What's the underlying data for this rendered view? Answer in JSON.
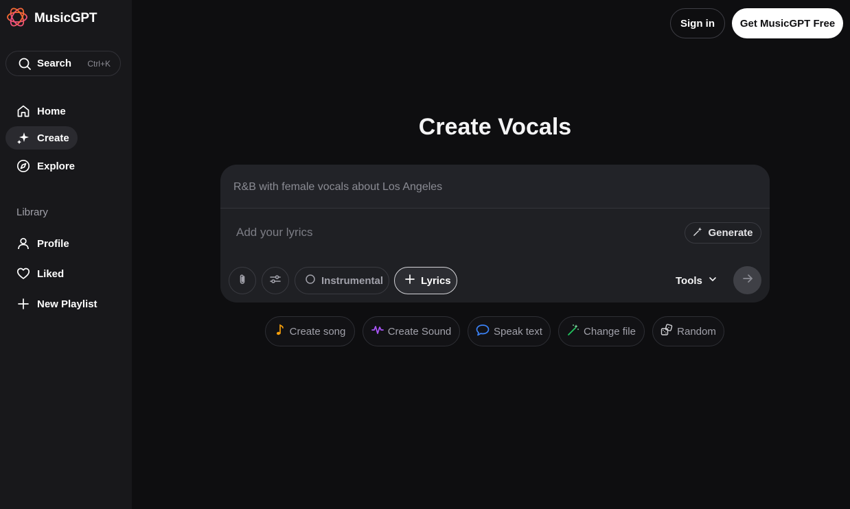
{
  "app": {
    "name": "MusicGPT"
  },
  "sidebar": {
    "search": {
      "label": "Search",
      "shortcut": "Ctrl+K"
    },
    "nav": [
      {
        "label": "Home",
        "icon": "home-icon"
      },
      {
        "label": "Create",
        "icon": "sparkle-icon",
        "active": true
      },
      {
        "label": "Explore",
        "icon": "compass-icon"
      }
    ],
    "library_label": "Library",
    "library": [
      {
        "label": "Profile",
        "icon": "user-icon"
      },
      {
        "label": "Liked",
        "icon": "heart-icon"
      },
      {
        "label": "New Playlist",
        "icon": "plus-icon"
      }
    ]
  },
  "header": {
    "signin_label": "Sign in",
    "cta_label": "Get MusicGPT Free"
  },
  "main": {
    "title": "Create Vocals",
    "prompt": {
      "placeholder": "R&B with female vocals about Los Angeles"
    },
    "lyrics": {
      "placeholder": "Add your lyrics"
    },
    "generate_label": "Generate",
    "toolbar": {
      "attach_icon": "paperclip-icon",
      "settings_icon": "sliders-icon",
      "instrumental_label": "Instrumental",
      "lyrics_label": "Lyrics",
      "tools_label": "Tools"
    },
    "quick_actions": [
      {
        "label": "Create song",
        "icon": "music-note-icon",
        "color": "#f59e0b"
      },
      {
        "label": "Create Sound",
        "icon": "waveform-icon",
        "color": "#a855f7"
      },
      {
        "label": "Speak text",
        "icon": "speech-bubble-icon",
        "color": "#3b82f6"
      },
      {
        "label": "Change file",
        "icon": "magic-wand-icon",
        "color": "#22c55e"
      },
      {
        "label": "Random",
        "icon": "dice-icon",
        "color": "#d4d4d8"
      }
    ]
  },
  "colors": {
    "background": "#0e0e10",
    "sidebar": "#18181b",
    "composer": "#1f2024",
    "logo_gradient": [
      "#f97316",
      "#ec4899"
    ]
  }
}
